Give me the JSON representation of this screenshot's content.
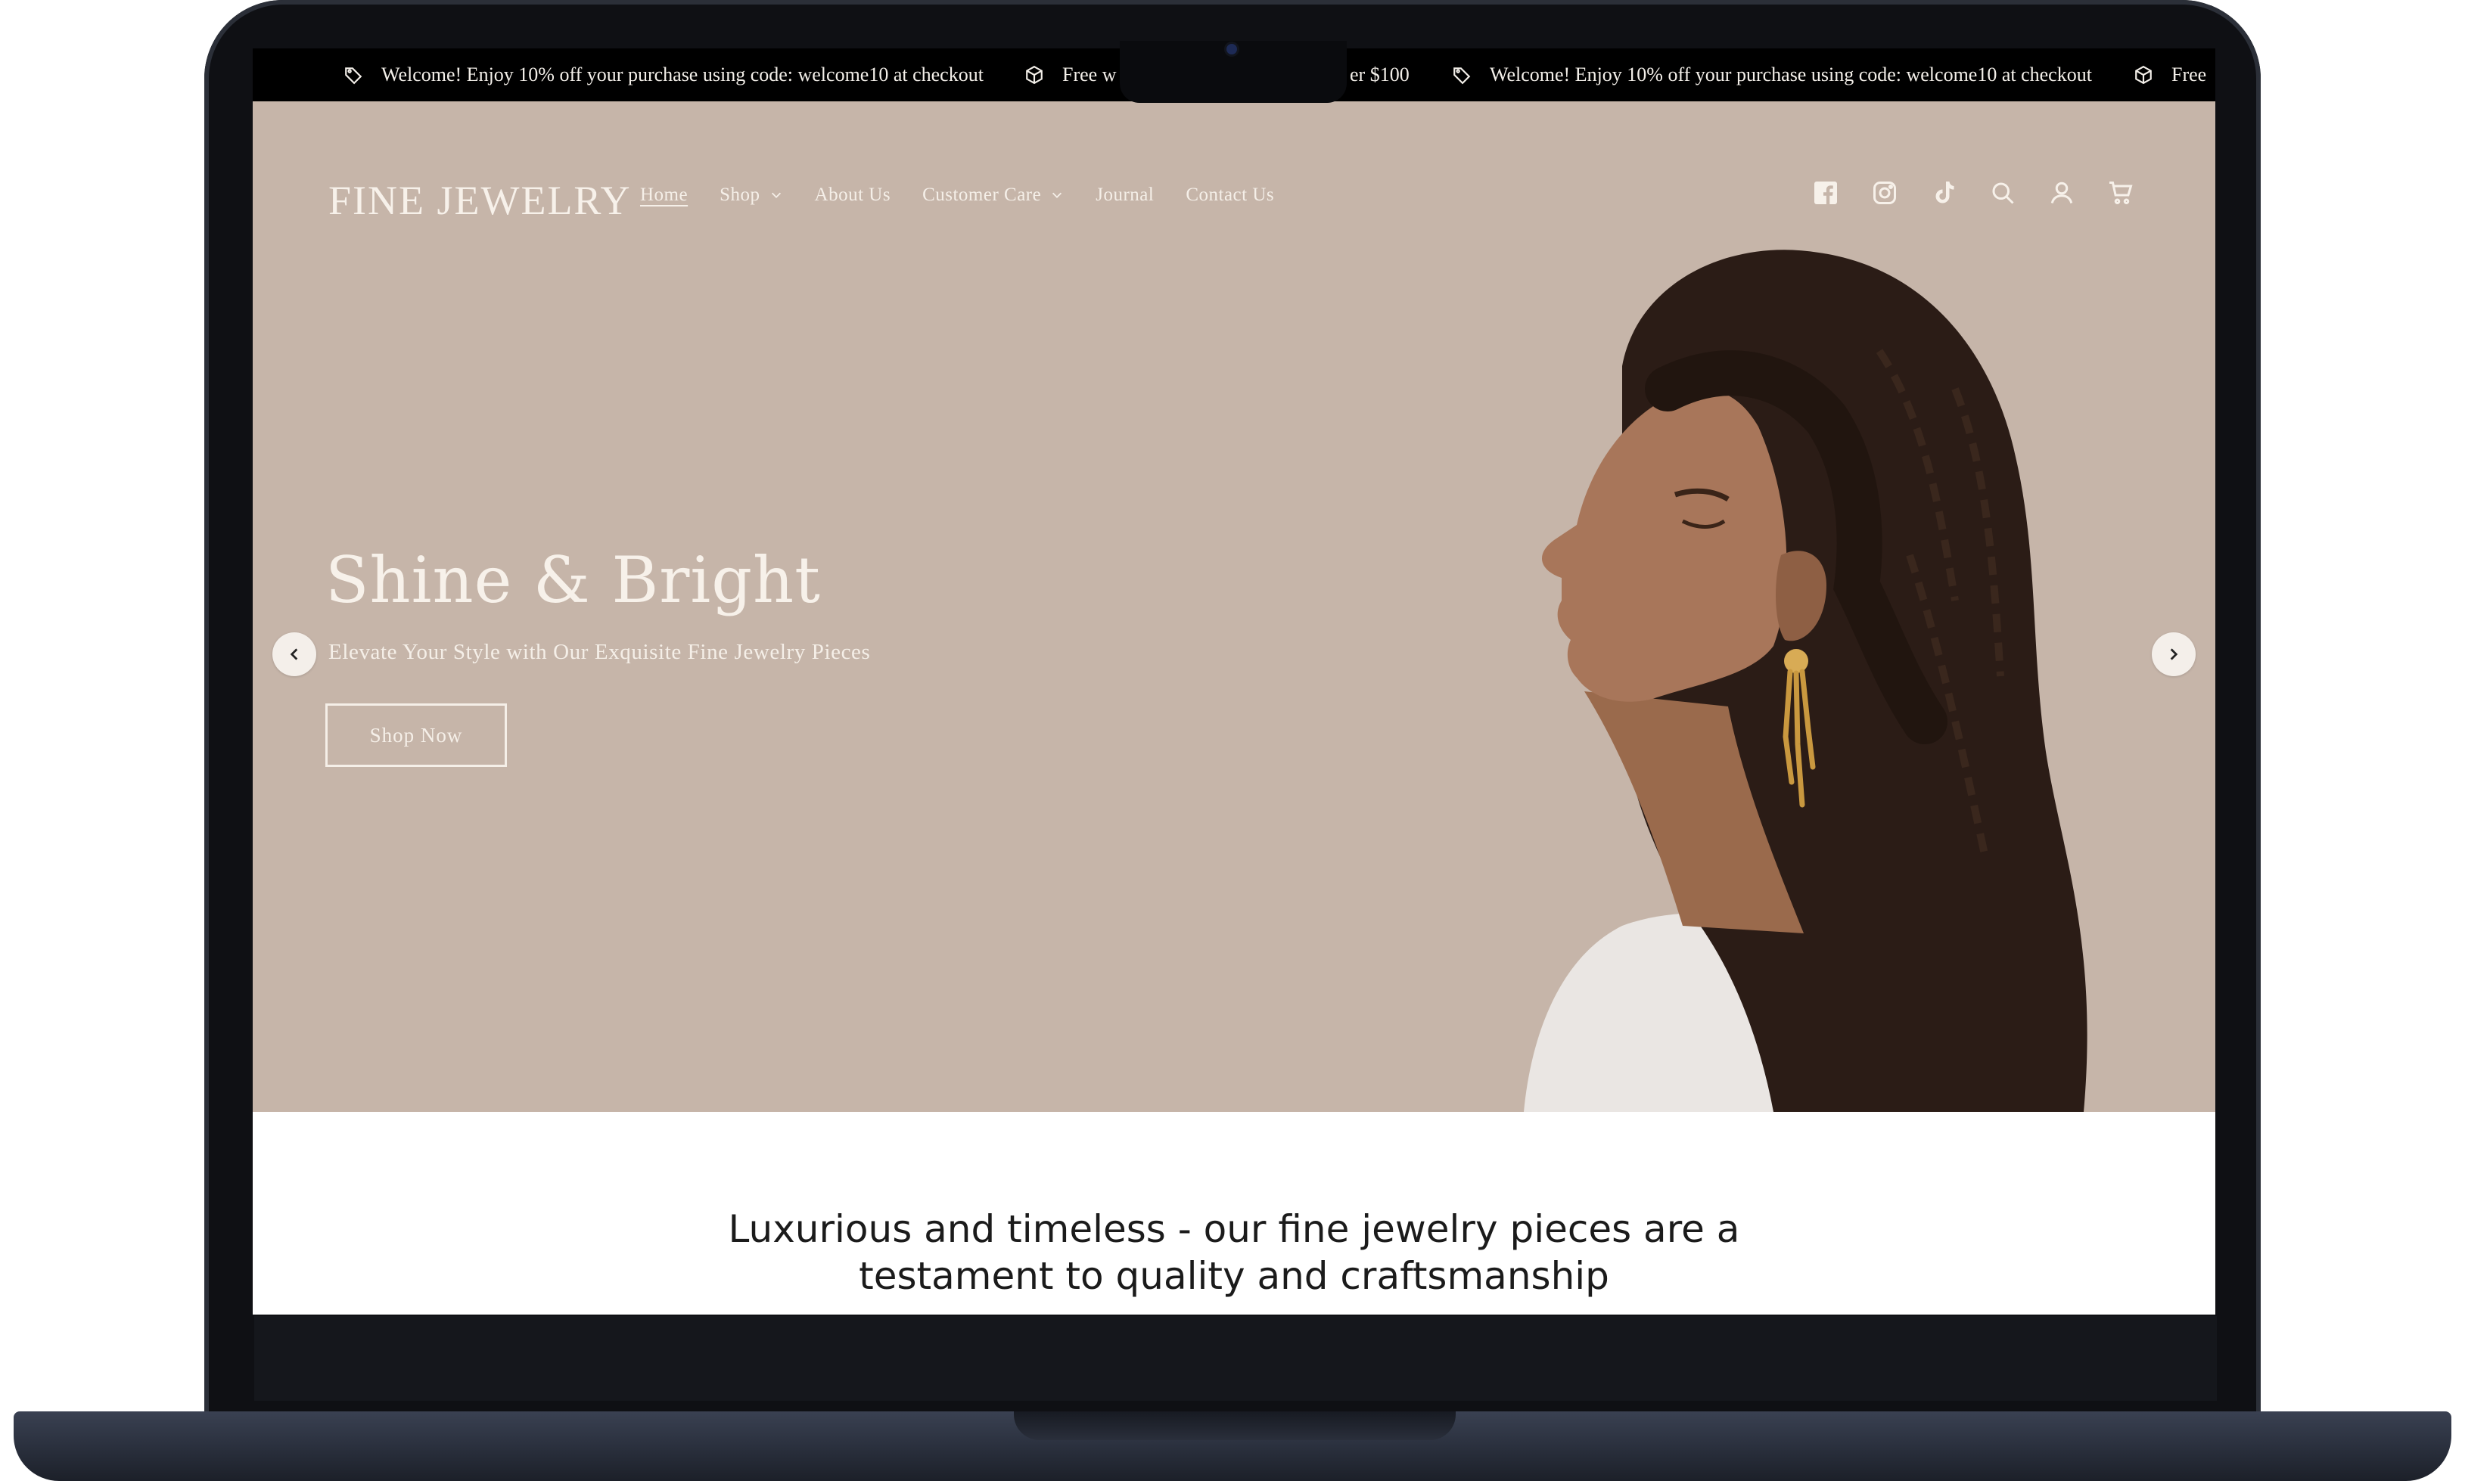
{
  "announcement_bar": {
    "items": [
      {
        "text": "Welcome! Enjoy 10% off your purchase using code: welcome10 at checkout",
        "icon": "tag-icon"
      },
      {
        "text": "Free w",
        "icon": "box-icon"
      },
      {
        "text": "er $100",
        "icon": ""
      },
      {
        "text": "Welcome! Enjoy 10% off your purchase using code: welcome10 at checkout",
        "icon": "tag-icon"
      },
      {
        "text": "Free",
        "icon": "box-icon"
      }
    ]
  },
  "header": {
    "logo": "FINE JEWELRY",
    "nav": [
      {
        "label": "Home",
        "active": true,
        "dropdown": false
      },
      {
        "label": "Shop",
        "active": false,
        "dropdown": true
      },
      {
        "label": "About Us",
        "active": false,
        "dropdown": false
      },
      {
        "label": "Customer Care",
        "active": false,
        "dropdown": true
      },
      {
        "label": "Journal",
        "active": false,
        "dropdown": false
      },
      {
        "label": "Contact Us",
        "active": false,
        "dropdown": false
      }
    ],
    "icons": [
      "facebook-icon",
      "instagram-icon",
      "tiktok-icon",
      "search-icon",
      "account-icon",
      "cart-icon"
    ]
  },
  "hero": {
    "title": "Shine & Bright",
    "subtitle": "Elevate Your Style with Our Exquisite Fine Jewelry Pieces",
    "button_label": "Shop Now",
    "background_color": "#c6b5a9",
    "arrows": [
      "chevron-left-icon",
      "chevron-right-icon"
    ]
  },
  "intro": {
    "line1": "Luxurious and timeless - our fine jewelry pieces are a",
    "line2": "testament to quality and craftsmanship"
  },
  "colors": {
    "announcement_bg": "#000000",
    "hero_text": "#f7f1ea",
    "body_text": "#1b1b1b",
    "laptop_frame": "#0f1014"
  }
}
